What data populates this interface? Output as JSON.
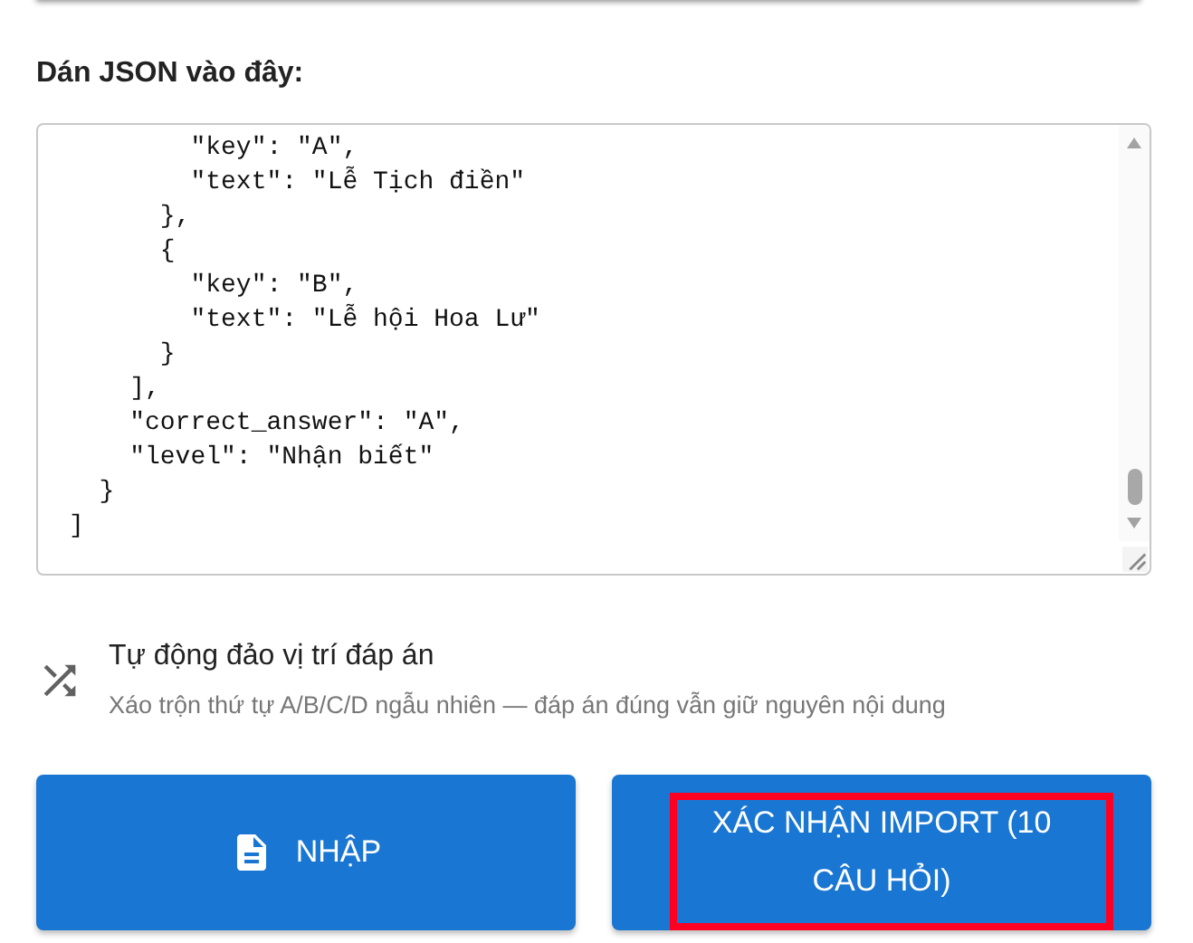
{
  "json_input": {
    "label": "Dán JSON vào đây:",
    "value_lines": [
      "        \"key\": \"A\",",
      "        \"text\": \"Lễ Tịch điền\"",
      "      },",
      "      {",
      "        \"key\": \"B\",",
      "        \"text\": \"Lễ hội Hoa Lư\"",
      "      }",
      "    ],",
      "    \"correct_answer\": \"A\",",
      "    \"level\": \"Nhận biết\"",
      "  }",
      "]"
    ]
  },
  "shuffle_option": {
    "title": "Tự động đảo vị trí đáp án",
    "description": "Xáo trộn thứ tự A/B/C/D ngẫu nhiên — đáp án đúng vẫn giữ nguyên nội dung"
  },
  "buttons": [
    {
      "kind": "file",
      "label": "NHẬP",
      "highlighted": false
    },
    {
      "kind": "plain",
      "label": "XÁC NHẬN IMPORT (10 CÂU HỎI)",
      "highlighted": true
    }
  ]
}
